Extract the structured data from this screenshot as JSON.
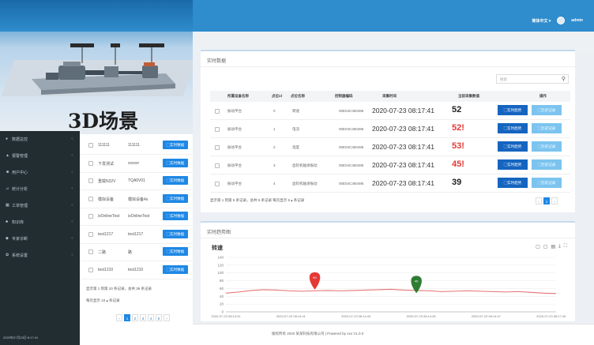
{
  "header": {
    "lang": "简体中文 ▾",
    "user": "admin"
  },
  "scene": {
    "title": "3D场景"
  },
  "sidebar": {
    "items": [
      {
        "icon": "●",
        "label": "数据总控",
        "icon_name": "dashboard-icon"
      },
      {
        "icon": "▲",
        "label": "报警管理",
        "icon_name": "alarm-icon"
      },
      {
        "icon": "☻",
        "label": "用户中心",
        "icon_name": "user-icon"
      },
      {
        "icon": "⊿",
        "label": "统计分析",
        "icon_name": "stats-icon"
      },
      {
        "icon": "▦",
        "label": "工单管理",
        "icon_name": "workorder-icon"
      },
      {
        "icon": "♣",
        "label": "知识库",
        "icon_name": "knowledge-icon"
      },
      {
        "icon": "◆",
        "label": "专家诊断",
        "icon_name": "expert-icon"
      },
      {
        "icon": "✿",
        "label": "系统设置",
        "icon_name": "settings-icon"
      }
    ],
    "arrow": "‹",
    "footer": "2020年07月23日 8:17:41"
  },
  "device_list": {
    "rows": [
      {
        "c1": "111111",
        "c2": "111111"
      },
      {
        "c1": "下发测试",
        "c2": "xxxxxr"
      },
      {
        "c1": "重载N32V",
        "c2": "TQA0V01"
      },
      {
        "c1": "模拟设备",
        "c2": "模拟设备4s"
      },
      {
        "c1": "isOnlineTest",
        "c2": "isOnlineTest"
      },
      {
        "c1": "test1217",
        "c2": "test1217"
      },
      {
        "c1": "二路",
        "c2": "路"
      },
      {
        "c1": "test1210",
        "c2": "test1210"
      }
    ],
    "button": "▢实时数据",
    "summary": "显示第 1 到第 10 条记录，总共 36 条记录",
    "per_page": "每页显示  10 ▴  条记录",
    "pager": [
      "‹",
      "1",
      "2",
      "3",
      "4",
      "5",
      "›"
    ]
  },
  "realtime": {
    "title": "实时数据",
    "search_placeholder": "搜索",
    "columns": [
      "所属设备名称",
      "点位id",
      "点位名称",
      "控制器编码",
      "采集时间",
      "当前采集数值",
      "操作"
    ],
    "rows": [
      {
        "device": "振动平台",
        "id": "0",
        "name": "转速",
        "code": "00E04C360495",
        "time": "2020-07-23 08:17:41",
        "value": "52",
        "alarm": false
      },
      {
        "device": "振动平台",
        "id": "1",
        "name": "电流",
        "code": "00E04C360495",
        "time": "2020-07-23 08:17:41",
        "value": "52!",
        "alarm": true
      },
      {
        "device": "振动平台",
        "id": "2",
        "name": "温度",
        "code": "00E04C360495",
        "time": "2020-07-23 08:17:41",
        "value": "53!",
        "alarm": true
      },
      {
        "device": "振动平台",
        "id": "3",
        "name": "齿轮机轴承振动",
        "code": "00E04C360495",
        "time": "2020-07-23 08:17:41",
        "value": "45!",
        "alarm": true
      },
      {
        "device": "振动平台",
        "id": "4",
        "name": "齿轮机轴承振动",
        "code": "00E04C360495",
        "time": "2020-07-23 08:17:41",
        "value": "39",
        "alarm": false
      }
    ],
    "btn_trend": "▢实时趋势",
    "btn_history": "▢历史记录",
    "summary": "显示第 1 到第 5 条记录，总共 5 条记录  每页显示  5 ▴  条记录",
    "pager": [
      "‹",
      "1",
      "›"
    ]
  },
  "trend": {
    "title": "实时趋势图",
    "series_label": "转速",
    "tools": [
      "▢",
      "▢",
      "▤",
      "⤓",
      "⛶"
    ]
  },
  "chart_data": {
    "type": "line",
    "title": "转速",
    "yticks": [
      0,
      20,
      40,
      60,
      80,
      100,
      120,
      140
    ],
    "ylim": [
      0,
      140
    ],
    "xticks": [
      "2020-07-23 08:14:31",
      "2020-07-23 08:14:41",
      "2020-07-23 08:14:43",
      "2020-07-23 08:14:45",
      "2020-07-23 08:14:47",
      "2020-07-23 08:17:40"
    ],
    "series": [
      {
        "color": "#e57373",
        "values": [
          48,
          51,
          55,
          57,
          56,
          54,
          53,
          54,
          55,
          54,
          55,
          56,
          57,
          58,
          56,
          55,
          54,
          52,
          53,
          54,
          53,
          52,
          51,
          52,
          50,
          48,
          47
        ]
      }
    ],
    "markers": [
      {
        "label": "60",
        "index": 7,
        "value": 57,
        "color": "#e53935"
      },
      {
        "label": "40",
        "index": 15,
        "value": 48,
        "color": "#2e7d32"
      }
    ]
  },
  "footer": {
    "text": "版权所有 2020 某某科技有限公司  |  Powered by xxx  V1.0.0"
  }
}
